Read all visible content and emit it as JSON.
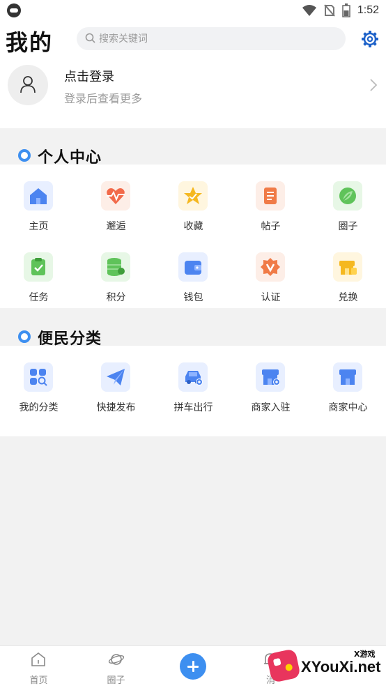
{
  "status_bar": {
    "time": "1:52"
  },
  "header": {
    "title": "我的",
    "search_placeholder": "搜索关键词"
  },
  "login": {
    "title": "点击登录",
    "subtitle": "登录后查看更多"
  },
  "personal_center": {
    "title": "个人中心",
    "items": [
      {
        "label": "主页",
        "icon": "home-icon",
        "tile": "#e8efff",
        "color": "#4c84f0"
      },
      {
        "label": "邂逅",
        "icon": "heartbeat-icon",
        "tile": "#fdeee7",
        "color": "#f26a4a"
      },
      {
        "label": "收藏",
        "icon": "star-icon",
        "tile": "#fff6df",
        "color": "#f5b820"
      },
      {
        "label": "帖子",
        "icon": "scroll-icon",
        "tile": "#fdeee7",
        "color": "#f07b47"
      },
      {
        "label": "圈子",
        "icon": "leaf-icon",
        "tile": "#e7f7e6",
        "color": "#5fc35a"
      },
      {
        "label": "任务",
        "icon": "clipboard-check-icon",
        "tile": "#e7f7e6",
        "color": "#5fc35a"
      },
      {
        "label": "积分",
        "icon": "coins-icon",
        "tile": "#e7f7e6",
        "color": "#5fc35a"
      },
      {
        "label": "钱包",
        "icon": "wallet-icon",
        "tile": "#e8efff",
        "color": "#4c84f0"
      },
      {
        "label": "认证",
        "icon": "badge-v-icon",
        "tile": "#fdeee7",
        "color": "#f07b47"
      },
      {
        "label": "兑换",
        "icon": "exchange-icon",
        "tile": "#fff6df",
        "color": "#f5b820"
      }
    ]
  },
  "services": {
    "title": "便民分类",
    "items": [
      {
        "label": "我的分类",
        "icon": "grid-search-icon",
        "tile": "#e8efff",
        "color": "#4c84f0"
      },
      {
        "label": "快捷发布",
        "icon": "paper-plane-icon",
        "tile": "#e8efff",
        "color": "#4c84f0"
      },
      {
        "label": "拼车出行",
        "icon": "car-icon",
        "tile": "#e8efff",
        "color": "#4c84f0"
      },
      {
        "label": "商家入驻",
        "icon": "store-add-icon",
        "tile": "#e8efff",
        "color": "#4c84f0"
      },
      {
        "label": "商家中心",
        "icon": "store-icon",
        "tile": "#e8efff",
        "color": "#4c84f0"
      }
    ]
  },
  "bottom_nav": {
    "items": [
      {
        "label": "首页",
        "icon": "home-outline-icon"
      },
      {
        "label": "圈子",
        "icon": "planet-icon"
      },
      {
        "label": "",
        "icon": "plus-icon"
      },
      {
        "label": "消",
        "icon": "bell-icon"
      },
      {
        "label": "",
        "icon": "profile-icon"
      }
    ]
  },
  "watermark": {
    "brand": "XYouXi.net",
    "small": "X游戏"
  },
  "colors": {
    "accent": "#3d8ff0",
    "background": "#f2f2f2"
  }
}
